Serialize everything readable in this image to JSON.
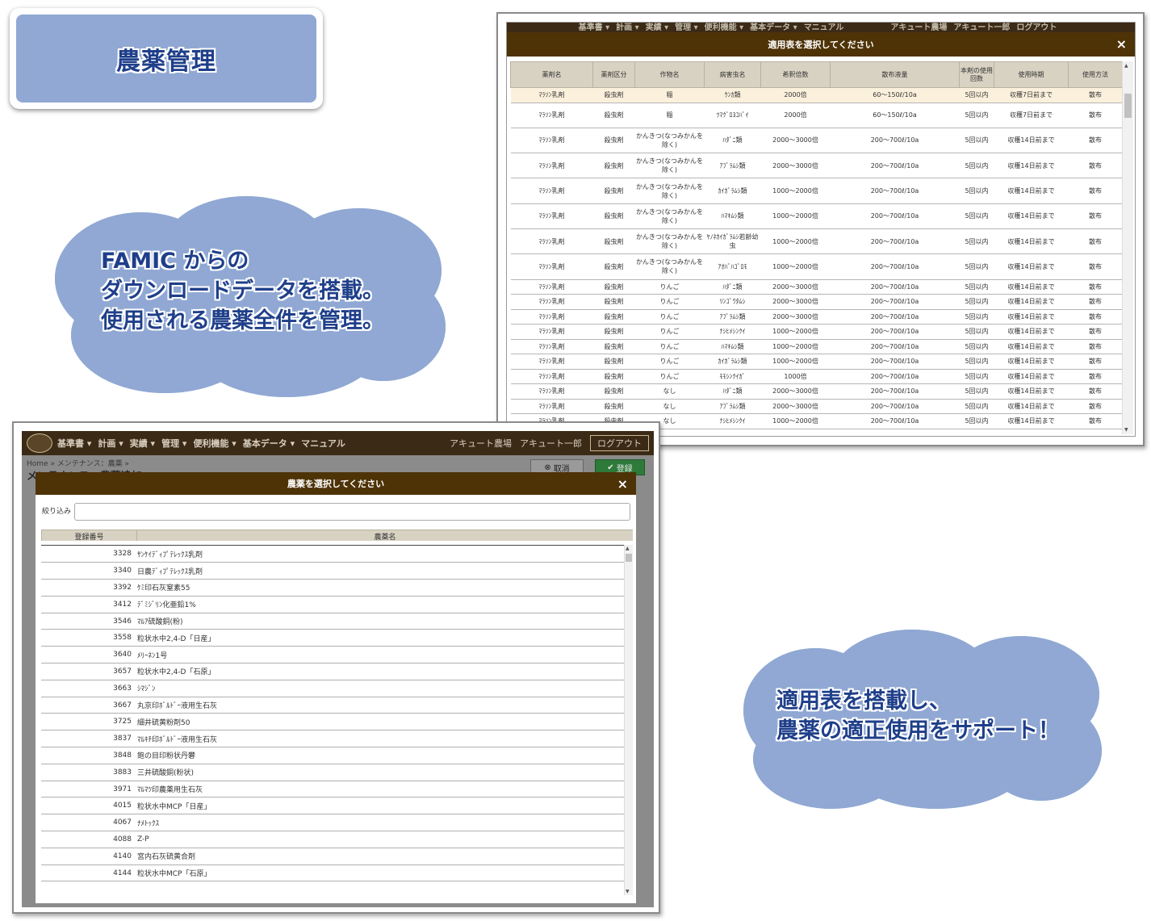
{
  "title": "農薬管理",
  "cloud_left": {
    "lines": [
      "FAMIC からの",
      "ダウンロードデータを搭載。",
      "使用される農薬全件を管理。"
    ]
  },
  "cloud_right": {
    "lines": [
      "適用表を搭載し、",
      "農薬の適正使用をサポート！"
    ]
  },
  "nav": {
    "items": [
      "基準書 ▾",
      "計画 ▾",
      "実績 ▾",
      "管理 ▾",
      "便利機能 ▾",
      "基本データ ▾",
      "マニュアル"
    ],
    "farm": "アキュート農場",
    "user": "アキュート一郎",
    "logout": "ログアウト"
  },
  "table_modal": {
    "title": "適用表を選択してください",
    "close": "×",
    "headers": [
      "薬剤名",
      "薬剤区分",
      "作物名",
      "病害虫名",
      "希釈倍数",
      "散布液量",
      "本剤の使用回数",
      "使用時期",
      "使用方法"
    ],
    "rows": [
      [
        "ﾏﾗｿﾝ乳剤",
        "殺虫剤",
        "稲",
        "ｳﾝｶ類",
        "2000倍",
        "60～150ℓ/10a",
        "5回以内",
        "収穫7日前まで",
        "散布"
      ],
      [
        "ﾏﾗｿﾝ乳剤",
        "殺虫剤",
        "稲",
        "ﾂﾏｸﾞﾛﾖｺﾊﾞｲ",
        "2000倍",
        "60～150ℓ/10a",
        "5回以内",
        "収穫7日前まで",
        "散布"
      ],
      [
        "ﾏﾗｿﾝ乳剤",
        "殺虫剤",
        "かんきつ(なつみかんを除く)",
        "ﾊﾀﾞﾆ類",
        "2000～3000倍",
        "200～700ℓ/10a",
        "5回以内",
        "収穫14日前まで",
        "散布"
      ],
      [
        "ﾏﾗｿﾝ乳剤",
        "殺虫剤",
        "かんきつ(なつみかんを除く)",
        "ｱﾌﾞﾗﾑｼ類",
        "2000～3000倍",
        "200～700ℓ/10a",
        "5回以内",
        "収穫14日前まで",
        "散布"
      ],
      [
        "ﾏﾗｿﾝ乳剤",
        "殺虫剤",
        "かんきつ(なつみかんを除く)",
        "ｶｲｶﾞﾗﾑｼ類",
        "1000～2000倍",
        "200～700ℓ/10a",
        "5回以内",
        "収穫14日前まで",
        "散布"
      ],
      [
        "ﾏﾗｿﾝ乳剤",
        "殺虫剤",
        "かんきつ(なつみかんを除く)",
        "ﾊﾏｷﾑｼ類",
        "1000～2000倍",
        "200～700ℓ/10a",
        "5回以内",
        "収穫14日前まで",
        "散布"
      ],
      [
        "ﾏﾗｿﾝ乳剤",
        "殺虫剤",
        "かんきつ(なつみかんを除く)",
        "ﾔﾉﾈｶｲｶﾞﾗﾑｼ若齢幼虫",
        "1000～2000倍",
        "200～700ℓ/10a",
        "5回以内",
        "収穫14日前まで",
        "散布"
      ],
      [
        "ﾏﾗｿﾝ乳剤",
        "殺虫剤",
        "かんきつ(なつみかんを除く)",
        "ｱｵﾊﾞﾊｺﾞﾛﾓ",
        "1000～2000倍",
        "200～700ℓ/10a",
        "5回以内",
        "収穫14日前まで",
        "散布"
      ],
      [
        "ﾏﾗｿﾝ乳剤",
        "殺虫剤",
        "りんご",
        "ﾊﾀﾞﾆ類",
        "2000～3000倍",
        "200～700ℓ/10a",
        "5回以内",
        "収穫14日前まで",
        "散布"
      ],
      [
        "ﾏﾗｿﾝ乳剤",
        "殺虫剤",
        "りんご",
        "ﾘﾝｺﾞﾜﾀﾑｼ",
        "2000～3000倍",
        "200～700ℓ/10a",
        "5回以内",
        "収穫14日前まで",
        "散布"
      ],
      [
        "ﾏﾗｿﾝ乳剤",
        "殺虫剤",
        "りんご",
        "ｱﾌﾞﾗﾑｼ類",
        "2000～3000倍",
        "200～700ℓ/10a",
        "5回以内",
        "収穫14日前まで",
        "散布"
      ],
      [
        "ﾏﾗｿﾝ乳剤",
        "殺虫剤",
        "りんご",
        "ﾅｼﾋﾒｼﾝｸｲ",
        "1000～2000倍",
        "200～700ℓ/10a",
        "5回以内",
        "収穫14日前まで",
        "散布"
      ],
      [
        "ﾏﾗｿﾝ乳剤",
        "殺虫剤",
        "りんご",
        "ﾊﾏｷﾑｼ類",
        "1000～2000倍",
        "200～700ℓ/10a",
        "5回以内",
        "収穫14日前まで",
        "散布"
      ],
      [
        "ﾏﾗｿﾝ乳剤",
        "殺虫剤",
        "りんご",
        "ｶｲｶﾞﾗﾑｼ類",
        "1000～2000倍",
        "200～700ℓ/10a",
        "5回以内",
        "収穫14日前まで",
        "散布"
      ],
      [
        "ﾏﾗｿﾝ乳剤",
        "殺虫剤",
        "りんご",
        "ﾓﾓｼﾝｸｲｶﾞ",
        "1000倍",
        "200～700ℓ/10a",
        "5回以内",
        "収穫14日前まで",
        "散布"
      ],
      [
        "ﾏﾗｿﾝ乳剤",
        "殺虫剤",
        "なし",
        "ﾊﾀﾞﾆ類",
        "2000～3000倍",
        "200～700ℓ/10a",
        "5回以内",
        "収穫14日前まで",
        "散布"
      ],
      [
        "ﾏﾗｿﾝ乳剤",
        "殺虫剤",
        "なし",
        "ｱﾌﾞﾗﾑｼ類",
        "2000～3000倍",
        "200～700ℓ/10a",
        "5回以内",
        "収穫14日前まで",
        "散布"
      ],
      [
        "ﾏﾗｿﾝ乳剤",
        "殺虫剤",
        "なし",
        "ﾅｼﾋﾒｼﾝｸｲ",
        "1000～2000倍",
        "200～700ℓ/10a",
        "5回以内",
        "収穫14日前まで",
        "散布"
      ]
    ]
  },
  "bottom_page": {
    "breadcrumb": "Home  »  メンテナンス：農薬  »",
    "page_title": "メンテナンス：農薬追加",
    "cancel": "取消",
    "register": "登録"
  },
  "pesticide_modal": {
    "title": "農薬を選択してください",
    "close": "×",
    "filter_label": "絞り込み",
    "filter_value": "",
    "headers": [
      "登録番号",
      "農薬名"
    ],
    "rows": [
      [
        "3328",
        "ｻﾝｹｲﾃﾞｨﾌﾟﾃﾚｯｸｽ乳剤"
      ],
      [
        "3340",
        "日農ﾃﾞｨﾌﾟﾃﾚｯｸｽ乳剤"
      ],
      [
        "3392",
        "ｹﾐ印石灰窒素55"
      ],
      [
        "3412",
        "ﾃﾞﾐｼﾞﾘﾝ化亜鉛1%"
      ],
      [
        "3546",
        "ﾏﾙｱ硫酸銅(粉)"
      ],
      [
        "3558",
        "粒状水中2,4-D「日産」"
      ],
      [
        "3640",
        "ﾒﾘｰﾈﾝ1号"
      ],
      [
        "3657",
        "粒状水中2,4-D「石原」"
      ],
      [
        "3663",
        "ｼﾏｼﾞﾝ"
      ],
      [
        "3667",
        "丸京印ﾎﾞﾙﾄﾞｰ液用生石灰"
      ],
      [
        "3725",
        "細井硫黄粉剤50"
      ],
      [
        "3837",
        "ﾏﾙｷﾁ印ﾎﾞﾙﾄﾞｰ液用生石灰"
      ],
      [
        "3848",
        "鉋の目印粉状丹礬"
      ],
      [
        "3883",
        "三井硫酸銅(粉状)"
      ],
      [
        "3971",
        "ﾏﾙﾏﾂ印農薬用生石灰"
      ],
      [
        "4015",
        "粒状水中MCP「日産」"
      ],
      [
        "4067",
        "ﾅﾒﾄｯｸｽ"
      ],
      [
        "4088",
        "Z-P"
      ],
      [
        "4140",
        "宮内石灰硫黄合剤"
      ],
      [
        "4144",
        "粒状水中MCP「石原」"
      ]
    ]
  }
}
